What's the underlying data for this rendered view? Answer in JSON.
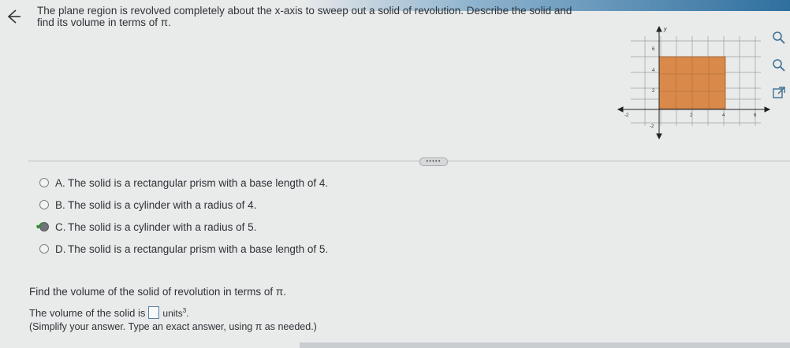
{
  "question": {
    "text": "The plane region is revolved completely about the x-axis to sweep out a solid of revolution. Describe the solid and find its volume in terms of π."
  },
  "graph": {
    "y_axis_label": "y",
    "y_ticks": [
      "6",
      "4",
      "2",
      "-2"
    ],
    "x_ticks": [
      "-2",
      "2",
      "4",
      "6"
    ],
    "region_color": "#d9894a"
  },
  "icons": {
    "back": "back-arrow-icon",
    "zoom_in": "zoom-in-icon",
    "zoom_out": "zoom-out-icon",
    "popout": "popout-icon"
  },
  "more_label": "•••••",
  "options": [
    {
      "letter": "A.",
      "text": "The solid is a rectangular prism with a base length of 4.",
      "selected": false
    },
    {
      "letter": "B.",
      "text": "The solid is a cylinder with a radius of 4.",
      "selected": false
    },
    {
      "letter": "C.",
      "text": "The solid is a cylinder with a radius of 5.",
      "selected": true
    },
    {
      "letter": "D.",
      "text": "The solid is a rectangular prism with a base length of 5.",
      "selected": false
    }
  ],
  "find_text": "Find the volume of the solid of revolution in terms of π.",
  "answer": {
    "prefix": "The volume of the solid is",
    "value": "",
    "unit": "units",
    "unit_exp": "3",
    "suffix": "."
  },
  "hint": "(Simplify your answer. Type an exact answer, using π as needed.)",
  "colors": {
    "check": "#2e8b2e",
    "accent": "#2f6f9e"
  }
}
